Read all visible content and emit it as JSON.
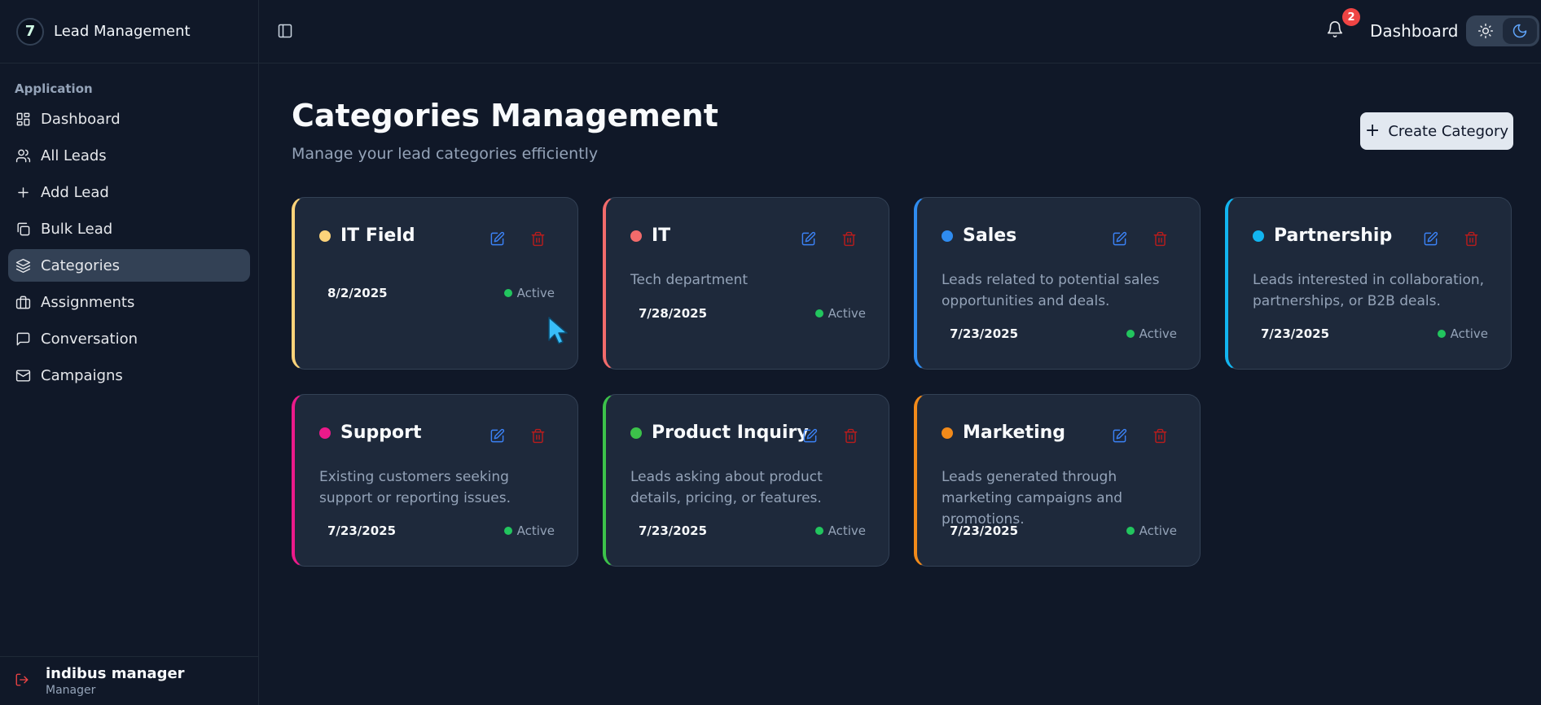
{
  "sidebar": {
    "brand": "Lead Management",
    "logo_glyph": "7",
    "section_label": "Application",
    "items": [
      {
        "label": "Dashboard",
        "icon": "dashboard-icon",
        "active": false
      },
      {
        "label": "All Leads",
        "icon": "users-icon",
        "active": false
      },
      {
        "label": "Add Lead",
        "icon": "plus-icon",
        "active": false
      },
      {
        "label": "Bulk Lead",
        "icon": "copy-icon",
        "active": false
      },
      {
        "label": "Categories",
        "icon": "layers-icon",
        "active": true
      },
      {
        "label": "Assignments",
        "icon": "briefcase-icon",
        "active": false
      },
      {
        "label": "Conversation",
        "icon": "message-icon",
        "active": false
      },
      {
        "label": "Campaigns",
        "icon": "mail-icon",
        "active": false
      }
    ],
    "user": {
      "name": "indibus manager",
      "role": "Manager"
    }
  },
  "header": {
    "title": "Dashboard",
    "notification_count": "2",
    "theme": "dark"
  },
  "main": {
    "title": "Categories Management",
    "subtitle": "Manage your lead categories efficiently",
    "create_label": "Create Category",
    "cards": [
      {
        "name": "IT Field",
        "color": "#fcd37a",
        "description": "",
        "date": "8/2/2025",
        "status": "Active"
      },
      {
        "name": "IT",
        "color": "#f26b6b",
        "description": "Tech department",
        "date": "7/28/2025",
        "status": "Active"
      },
      {
        "name": "Sales",
        "color": "#2f8cf0",
        "description": "Leads related to potential sales opportunities and deals.",
        "date": "7/23/2025",
        "status": "Active"
      },
      {
        "name": "Partnership",
        "color": "#12b5f0",
        "description": "Leads interested in collaboration, partnerships, or B2B deals.",
        "date": "7/23/2025",
        "status": "Active"
      },
      {
        "name": "Support",
        "color": "#ec1a8a",
        "description": "Existing customers seeking support or reporting issues.",
        "date": "7/23/2025",
        "status": "Active"
      },
      {
        "name": "Product Inquiry",
        "color": "#3cc24a",
        "description": "Leads asking about product details, pricing, or features.",
        "date": "7/23/2025",
        "status": "Active"
      },
      {
        "name": "Marketing",
        "color": "#f28a1a",
        "description": "Leads generated through marketing campaigns and promotions.",
        "date": "7/23/2025",
        "status": "Active"
      }
    ]
  }
}
